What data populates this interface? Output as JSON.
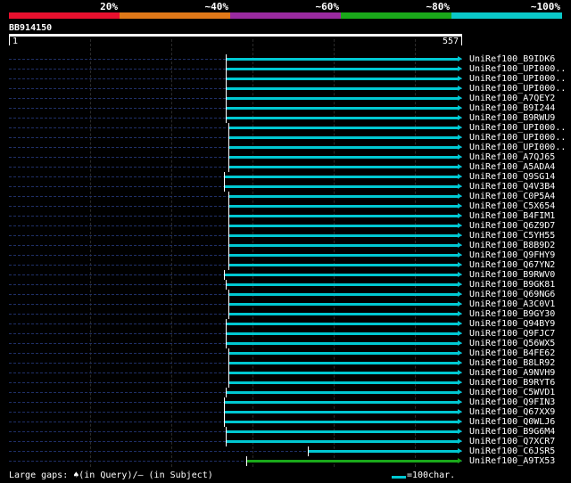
{
  "score_scale": {
    "labels": [
      "20%",
      "~40%",
      "~60%",
      "~80%",
      "~100%"
    ],
    "colors": [
      "#e8102e",
      "#e07818",
      "#9a2aa0",
      "#1aa81a",
      "#0ac8c8"
    ]
  },
  "query": {
    "name": "BB914150",
    "start": "1",
    "end": "557",
    "length": 557
  },
  "hits": [
    {
      "label": "UniRef100_B9IDK6",
      "start": 0.48,
      "color": "#00c8d2"
    },
    {
      "label": "UniRef100_UPI000..",
      "start": 0.48,
      "color": "#00c8d2"
    },
    {
      "label": "UniRef100_UPI000..",
      "start": 0.48,
      "color": "#00c8d2"
    },
    {
      "label": "UniRef100_UPI000..",
      "start": 0.48,
      "color": "#00c8d2"
    },
    {
      "label": "UniRef100_A7QEY2",
      "start": 0.48,
      "color": "#00c8d2"
    },
    {
      "label": "UniRef100_B9I244",
      "start": 0.48,
      "color": "#00c8d2"
    },
    {
      "label": "UniRef100_B9RWU9",
      "start": 0.48,
      "color": "#00c8d2"
    },
    {
      "label": "UniRef100_UPI000..",
      "start": 0.485,
      "color": "#00c8d2"
    },
    {
      "label": "UniRef100_UPI000..",
      "start": 0.485,
      "color": "#00c8d2"
    },
    {
      "label": "UniRef100_UPI000..",
      "start": 0.485,
      "color": "#00c8d2"
    },
    {
      "label": "UniRef100_A7QJ65",
      "start": 0.485,
      "color": "#00c8d2"
    },
    {
      "label": "UniRef100_A5ADA4",
      "start": 0.485,
      "color": "#00c8d2"
    },
    {
      "label": "UniRef100_Q9SG14",
      "start": 0.475,
      "color": "#00c8d2"
    },
    {
      "label": "UniRef100_Q4V3B4",
      "start": 0.475,
      "color": "#00c8d2"
    },
    {
      "label": "UniRef100_C0P5A4",
      "start": 0.485,
      "color": "#00c8d2"
    },
    {
      "label": "UniRef100_C5X654",
      "start": 0.485,
      "color": "#00c8d2"
    },
    {
      "label": "UniRef100_B4FIM1",
      "start": 0.485,
      "color": "#00c8d2"
    },
    {
      "label": "UniRef100_Q6Z9D7",
      "start": 0.485,
      "color": "#00c8d2"
    },
    {
      "label": "UniRef100_C5YH55",
      "start": 0.485,
      "color": "#00c8d2"
    },
    {
      "label": "UniRef100_B8B9D2",
      "start": 0.485,
      "color": "#00c8d2"
    },
    {
      "label": "UniRef100_Q9FHY9",
      "start": 0.485,
      "color": "#00c8d2"
    },
    {
      "label": "UniRef100_Q67YN2",
      "start": 0.485,
      "color": "#00c8d2"
    },
    {
      "label": "UniRef100_B9RWV0",
      "start": 0.475,
      "color": "#00c8d2"
    },
    {
      "label": "UniRef100_B9GK81",
      "start": 0.48,
      "color": "#00c8d2"
    },
    {
      "label": "UniRef100_Q69NG6",
      "start": 0.485,
      "color": "#00c8d2"
    },
    {
      "label": "UniRef100_A3C0V1",
      "start": 0.485,
      "color": "#00c8d2"
    },
    {
      "label": "UniRef100_B9GY30",
      "start": 0.485,
      "color": "#00c8d2"
    },
    {
      "label": "UniRef100_Q94BY9",
      "start": 0.48,
      "color": "#00c8d2"
    },
    {
      "label": "UniRef100_Q9FJC7",
      "start": 0.48,
      "color": "#00c8d2"
    },
    {
      "label": "UniRef100_Q56WX5",
      "start": 0.48,
      "color": "#00c8d2"
    },
    {
      "label": "UniRef100_B4FE62",
      "start": 0.485,
      "color": "#00c8d2"
    },
    {
      "label": "UniRef100_B8LR92",
      "start": 0.485,
      "color": "#00c8d2"
    },
    {
      "label": "UniRef100_A9NVH9",
      "start": 0.485,
      "color": "#00c8d2"
    },
    {
      "label": "UniRef100_B9RYT6",
      "start": 0.485,
      "color": "#00c8d2"
    },
    {
      "label": "UniRef100_C5WVD1",
      "start": 0.48,
      "color": "#00c8d2"
    },
    {
      "label": "UniRef100_Q9FIN3",
      "start": 0.475,
      "color": "#00c8d2"
    },
    {
      "label": "UniRef100_Q67XX9",
      "start": 0.475,
      "color": "#00c8d2"
    },
    {
      "label": "UniRef100_Q0WLJ6",
      "start": 0.475,
      "color": "#00c8d2"
    },
    {
      "label": "UniRef100_B9G6M4",
      "start": 0.48,
      "color": "#00c8d2"
    },
    {
      "label": "UniRef100_Q7XCR7",
      "start": 0.48,
      "color": "#00c8d2"
    },
    {
      "label": "UniRef100_C6JSR5",
      "start": 0.66,
      "color": "#00c8d2"
    },
    {
      "label": "UniRef100_A9TX53",
      "start": 0.525,
      "color": "#1aa81a"
    }
  ],
  "legend": {
    "gaps_text": "Large gaps: ♠(in Query)/– (in Subject)",
    "scale_text": "=100char."
  }
}
